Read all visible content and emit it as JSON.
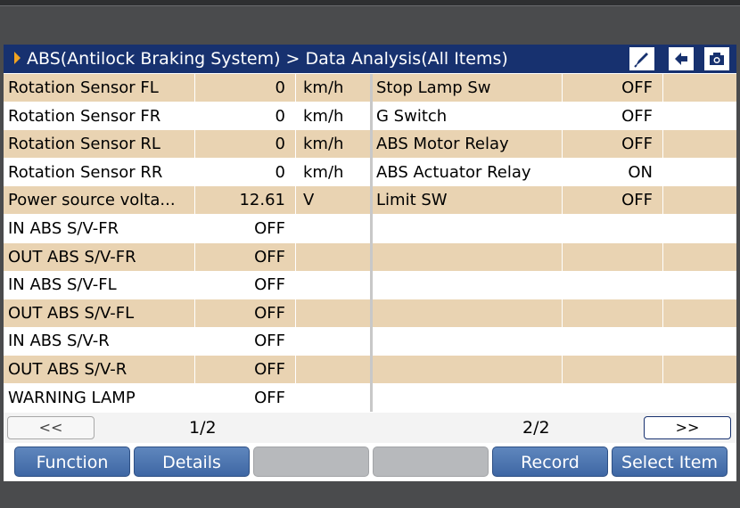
{
  "header": {
    "title": "ABS(Antilock Braking System) > Data Analysis(All Items)",
    "icons": [
      "pen-icon",
      "back-arrow-icon",
      "camera-icon"
    ]
  },
  "left_rows": [
    {
      "name": "Rotation Sensor FL",
      "value": "0",
      "unit": "km/h"
    },
    {
      "name": "Rotation Sensor FR",
      "value": "0",
      "unit": "km/h"
    },
    {
      "name": "Rotation Sensor RL",
      "value": "0",
      "unit": "km/h"
    },
    {
      "name": "Rotation Sensor RR",
      "value": "0",
      "unit": "km/h"
    },
    {
      "name": "Power source volta...",
      "value": "12.61",
      "unit": "V"
    },
    {
      "name": "IN ABS S/V-FR",
      "value": "OFF",
      "unit": ""
    },
    {
      "name": "OUT ABS S/V-FR",
      "value": "OFF",
      "unit": ""
    },
    {
      "name": "IN ABS S/V-FL",
      "value": "OFF",
      "unit": ""
    },
    {
      "name": "OUT ABS S/V-FL",
      "value": "OFF",
      "unit": ""
    },
    {
      "name": "IN ABS S/V-R",
      "value": "OFF",
      "unit": ""
    },
    {
      "name": "OUT ABS S/V-R",
      "value": "OFF",
      "unit": ""
    },
    {
      "name": "WARNING LAMP",
      "value": "OFF",
      "unit": ""
    }
  ],
  "right_rows": [
    {
      "name": "Stop Lamp Sw",
      "value": "OFF",
      "unit": ""
    },
    {
      "name": "G Switch",
      "value": "OFF",
      "unit": ""
    },
    {
      "name": "ABS Motor Relay",
      "value": "OFF",
      "unit": ""
    },
    {
      "name": "ABS Actuator Relay",
      "value": "ON",
      "unit": ""
    },
    {
      "name": "Limit SW",
      "value": "OFF",
      "unit": ""
    },
    {
      "name": "",
      "value": "",
      "unit": ""
    },
    {
      "name": "",
      "value": "",
      "unit": ""
    },
    {
      "name": "",
      "value": "",
      "unit": ""
    },
    {
      "name": "",
      "value": "",
      "unit": ""
    },
    {
      "name": "",
      "value": "",
      "unit": ""
    },
    {
      "name": "",
      "value": "",
      "unit": ""
    },
    {
      "name": "",
      "value": "",
      "unit": ""
    }
  ],
  "pager": {
    "prev_label": "<<",
    "next_label": ">>",
    "left_page": "1/2",
    "right_page": "2/2"
  },
  "buttons": {
    "function": "Function",
    "details": "Details",
    "blank1": "",
    "blank2": "",
    "record": "Record",
    "select_item": "Select Item"
  },
  "colors": {
    "header_bg": "#17316f",
    "row_tan": "#e9d3b2",
    "button_blue": "#4a72ad",
    "accent_arrow": "#f1a321"
  }
}
